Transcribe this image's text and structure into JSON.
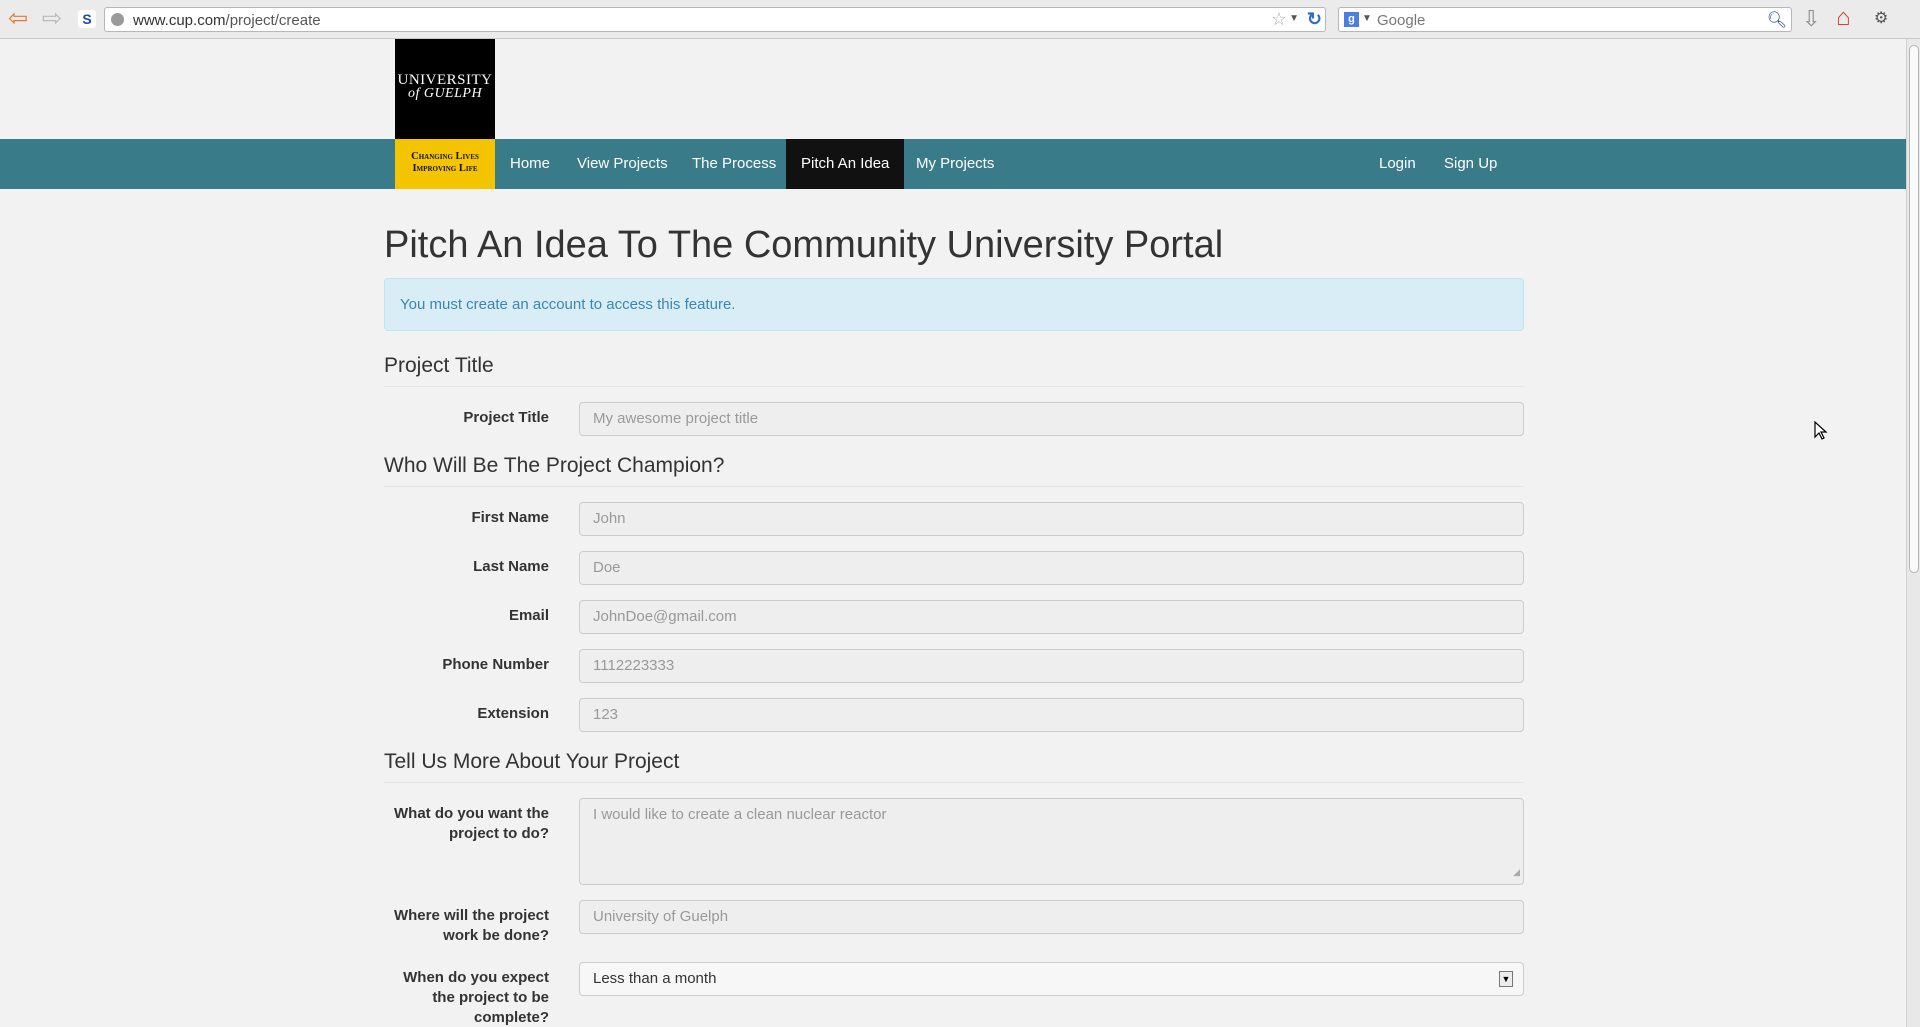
{
  "browser": {
    "url_domain": "www.cup.com",
    "url_path": "/project/create",
    "search_engine": "Google"
  },
  "brand": {
    "logo_line1": "UNIVERSITY",
    "logo_line2": "of GUELPH",
    "tagline_line1": "Changing Lives",
    "tagline_line2": "Improving Life",
    "accent_color": "#3a7b8a",
    "tagline_color": "#f5c400"
  },
  "nav": {
    "home": "Home",
    "view_projects": "View Projects",
    "process": "The Process",
    "pitch": "Pitch An Idea",
    "my_projects": "My Projects",
    "login": "Login",
    "signup": "Sign Up"
  },
  "page": {
    "title": "Pitch An Idea To The Community University Portal",
    "alert": "You must create an account to access this feature."
  },
  "sections": {
    "project_title": "Project Title",
    "champion": "Who Will Be The Project Champion?",
    "more": "Tell Us More About Your Project"
  },
  "fields": {
    "project_title": {
      "label": "Project Title",
      "placeholder": "My awesome project title"
    },
    "first_name": {
      "label": "First Name",
      "placeholder": "John"
    },
    "last_name": {
      "label": "Last Name",
      "placeholder": "Doe"
    },
    "email": {
      "label": "Email",
      "placeholder": "JohnDoe@gmail.com"
    },
    "phone": {
      "label": "Phone Number",
      "placeholder": "1112223333"
    },
    "extension": {
      "label": "Extension",
      "placeholder": "123"
    },
    "purpose": {
      "label_line1": "What do you want the",
      "label_line2": "project to do?",
      "placeholder": "I would like to create a clean nuclear reactor"
    },
    "location": {
      "label_line1": "Where will the project",
      "label_line2": "work be done?",
      "placeholder": "University of Guelph"
    },
    "duration": {
      "label_line1": "When do you expect",
      "label_line2": "the project to be",
      "label_line3": "complete?",
      "value": "Less than a month"
    }
  }
}
